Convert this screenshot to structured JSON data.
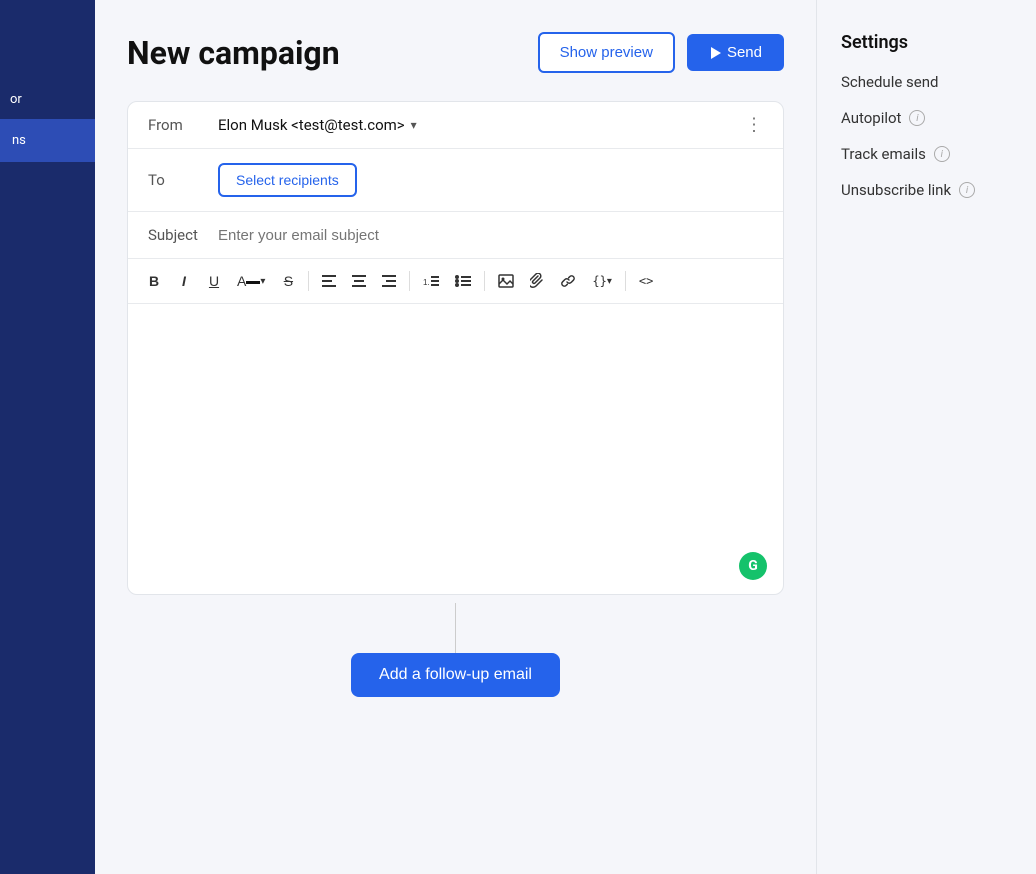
{
  "sidebar": {
    "or_label": "or",
    "active_item_label": "ns"
  },
  "header": {
    "page_title": "New campaign",
    "show_preview_label": "Show preview",
    "send_label": "Send"
  },
  "composer": {
    "from_label": "From",
    "from_value": "Elon Musk <test@test.com>",
    "to_label": "To",
    "select_recipients_label": "Select recipients",
    "subject_label": "Subject",
    "subject_placeholder": "Enter your email subject"
  },
  "toolbar": {
    "bold": "B",
    "italic": "I",
    "underline": "U",
    "strikethrough": "S",
    "align_left": "≡",
    "align_center": "≡",
    "align_right": "≡",
    "list_ordered": "≡",
    "list_unordered": "≡",
    "image": "🖼",
    "attachment": "📎",
    "link": "🔗",
    "code": "{}",
    "html": "<>",
    "chevron": "▾"
  },
  "settings": {
    "title": "Settings",
    "items": [
      {
        "label": "Schedule send",
        "has_info": false
      },
      {
        "label": "Autopilot",
        "has_info": true
      },
      {
        "label": "Track emails",
        "has_info": true
      },
      {
        "label": "Unsubscribe link",
        "has_info": true
      }
    ]
  },
  "follow_up": {
    "button_label": "Add a follow-up email"
  }
}
